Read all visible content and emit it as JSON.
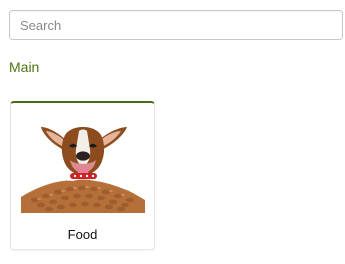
{
  "search": {
    "placeholder": "Search",
    "value": ""
  },
  "section": {
    "title": "Main"
  },
  "categories": [
    {
      "label": "Food",
      "image_icon": "dog-with-kibble-image"
    }
  ],
  "colors": {
    "section_title": "#4e7310",
    "card_top_border": "#4a6a12",
    "search_border": "#c9c9c9"
  }
}
